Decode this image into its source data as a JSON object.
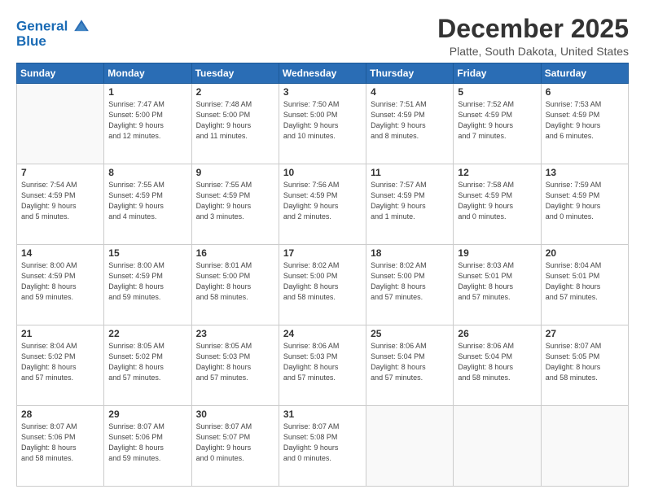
{
  "logo": {
    "line1": "General",
    "line2": "Blue"
  },
  "title": "December 2025",
  "subtitle": "Platte, South Dakota, United States",
  "days_header": [
    "Sunday",
    "Monday",
    "Tuesday",
    "Wednesday",
    "Thursday",
    "Friday",
    "Saturday"
  ],
  "weeks": [
    [
      {
        "day": "",
        "info": ""
      },
      {
        "day": "1",
        "info": "Sunrise: 7:47 AM\nSunset: 5:00 PM\nDaylight: 9 hours\nand 12 minutes."
      },
      {
        "day": "2",
        "info": "Sunrise: 7:48 AM\nSunset: 5:00 PM\nDaylight: 9 hours\nand 11 minutes."
      },
      {
        "day": "3",
        "info": "Sunrise: 7:50 AM\nSunset: 5:00 PM\nDaylight: 9 hours\nand 10 minutes."
      },
      {
        "day": "4",
        "info": "Sunrise: 7:51 AM\nSunset: 4:59 PM\nDaylight: 9 hours\nand 8 minutes."
      },
      {
        "day": "5",
        "info": "Sunrise: 7:52 AM\nSunset: 4:59 PM\nDaylight: 9 hours\nand 7 minutes."
      },
      {
        "day": "6",
        "info": "Sunrise: 7:53 AM\nSunset: 4:59 PM\nDaylight: 9 hours\nand 6 minutes."
      }
    ],
    [
      {
        "day": "7",
        "info": "Sunrise: 7:54 AM\nSunset: 4:59 PM\nDaylight: 9 hours\nand 5 minutes."
      },
      {
        "day": "8",
        "info": "Sunrise: 7:55 AM\nSunset: 4:59 PM\nDaylight: 9 hours\nand 4 minutes."
      },
      {
        "day": "9",
        "info": "Sunrise: 7:55 AM\nSunset: 4:59 PM\nDaylight: 9 hours\nand 3 minutes."
      },
      {
        "day": "10",
        "info": "Sunrise: 7:56 AM\nSunset: 4:59 PM\nDaylight: 9 hours\nand 2 minutes."
      },
      {
        "day": "11",
        "info": "Sunrise: 7:57 AM\nSunset: 4:59 PM\nDaylight: 9 hours\nand 1 minute."
      },
      {
        "day": "12",
        "info": "Sunrise: 7:58 AM\nSunset: 4:59 PM\nDaylight: 9 hours\nand 0 minutes."
      },
      {
        "day": "13",
        "info": "Sunrise: 7:59 AM\nSunset: 4:59 PM\nDaylight: 9 hours\nand 0 minutes."
      }
    ],
    [
      {
        "day": "14",
        "info": "Sunrise: 8:00 AM\nSunset: 4:59 PM\nDaylight: 8 hours\nand 59 minutes."
      },
      {
        "day": "15",
        "info": "Sunrise: 8:00 AM\nSunset: 4:59 PM\nDaylight: 8 hours\nand 59 minutes."
      },
      {
        "day": "16",
        "info": "Sunrise: 8:01 AM\nSunset: 5:00 PM\nDaylight: 8 hours\nand 58 minutes."
      },
      {
        "day": "17",
        "info": "Sunrise: 8:02 AM\nSunset: 5:00 PM\nDaylight: 8 hours\nand 58 minutes."
      },
      {
        "day": "18",
        "info": "Sunrise: 8:02 AM\nSunset: 5:00 PM\nDaylight: 8 hours\nand 57 minutes."
      },
      {
        "day": "19",
        "info": "Sunrise: 8:03 AM\nSunset: 5:01 PM\nDaylight: 8 hours\nand 57 minutes."
      },
      {
        "day": "20",
        "info": "Sunrise: 8:04 AM\nSunset: 5:01 PM\nDaylight: 8 hours\nand 57 minutes."
      }
    ],
    [
      {
        "day": "21",
        "info": "Sunrise: 8:04 AM\nSunset: 5:02 PM\nDaylight: 8 hours\nand 57 minutes."
      },
      {
        "day": "22",
        "info": "Sunrise: 8:05 AM\nSunset: 5:02 PM\nDaylight: 8 hours\nand 57 minutes."
      },
      {
        "day": "23",
        "info": "Sunrise: 8:05 AM\nSunset: 5:03 PM\nDaylight: 8 hours\nand 57 minutes."
      },
      {
        "day": "24",
        "info": "Sunrise: 8:06 AM\nSunset: 5:03 PM\nDaylight: 8 hours\nand 57 minutes."
      },
      {
        "day": "25",
        "info": "Sunrise: 8:06 AM\nSunset: 5:04 PM\nDaylight: 8 hours\nand 57 minutes."
      },
      {
        "day": "26",
        "info": "Sunrise: 8:06 AM\nSunset: 5:04 PM\nDaylight: 8 hours\nand 58 minutes."
      },
      {
        "day": "27",
        "info": "Sunrise: 8:07 AM\nSunset: 5:05 PM\nDaylight: 8 hours\nand 58 minutes."
      }
    ],
    [
      {
        "day": "28",
        "info": "Sunrise: 8:07 AM\nSunset: 5:06 PM\nDaylight: 8 hours\nand 58 minutes."
      },
      {
        "day": "29",
        "info": "Sunrise: 8:07 AM\nSunset: 5:06 PM\nDaylight: 8 hours\nand 59 minutes."
      },
      {
        "day": "30",
        "info": "Sunrise: 8:07 AM\nSunset: 5:07 PM\nDaylight: 9 hours\nand 0 minutes."
      },
      {
        "day": "31",
        "info": "Sunrise: 8:07 AM\nSunset: 5:08 PM\nDaylight: 9 hours\nand 0 minutes."
      },
      {
        "day": "",
        "info": ""
      },
      {
        "day": "",
        "info": ""
      },
      {
        "day": "",
        "info": ""
      }
    ]
  ]
}
